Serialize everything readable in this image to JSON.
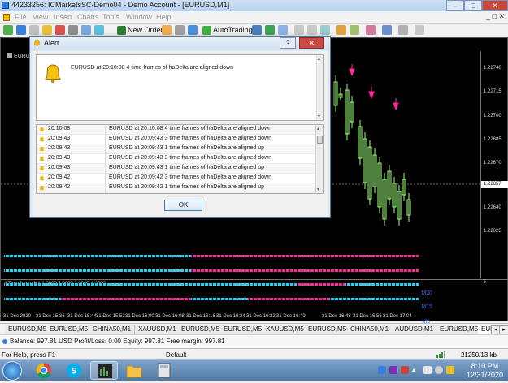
{
  "window": {
    "title": "44233256: ICMarketsSC-Demo04 - Demo Account - [EURUSD,M1]",
    "controls": [
      "–",
      "□",
      "✕"
    ]
  },
  "menu": [
    "File",
    "View",
    "Insert",
    "Charts",
    "Tools",
    "Window",
    "Help"
  ],
  "menu_controls": "_ □ ✕",
  "toolbar": {
    "new_order": "New Order",
    "autotrading": "AutoTrading"
  },
  "chart": {
    "caption": "EURUSD,M1",
    "prices": [
      "1.22740",
      "1.22715",
      "1.22700",
      "1.22685",
      "1.22670",
      "1.22657",
      "1.22640",
      "1.22625"
    ],
    "current_price": "1.22657",
    "indicator_caption": "4 Time frame HA 1.0000 2.0000 3.0000 4.0000",
    "indicator_rows": [
      "M30",
      "M15",
      "M5",
      "M1"
    ],
    "indicator_axis_top": "5",
    "indicator_axis_bottom": "0",
    "time_ticks": [
      "31 Dec 2020",
      "31 Dec 15:36",
      "31 Dec 15:44",
      "31 Dec 15:52",
      "31 Dec 16:00",
      "31 Dec 16:08",
      "31 Dec 16:16",
      "31 Dec 16:24",
      "31 Dec 16:32",
      "31 Dec 16:40",
      "31 Dec 16:48",
      "31 Dec 16:56",
      "31 Dec 17:04"
    ]
  },
  "colors": {
    "bull_candle": "#9eff7a",
    "arrow": "#ff2aa0",
    "indicator_blue": "#21d4f4",
    "indicator_pink": "#ff2a9a"
  },
  "alert": {
    "title": "Alert",
    "help": "?",
    "close": "✕",
    "message": "EURUSD at 20:10:08 4 time frames of haDelta are aligned down",
    "rows": [
      {
        "time": "20:10:08",
        "msg": "EURUSD at 20:10:08 4 time frames of haDelta are aligned down"
      },
      {
        "time": "20:09:43",
        "msg": "EURUSD at 20:09:43 3 time frames of haDelta are aligned down"
      },
      {
        "time": "20:09:43",
        "msg": "EURUSD at 20:09:43 1 time frames of haDelta are aligned up"
      },
      {
        "time": "20:09:43",
        "msg": "EURUSD at 20:09:43 3 time frames of haDelta are aligned down"
      },
      {
        "time": "20:09:43",
        "msg": "EURUSD at 20:09:43 1 time frames of haDelta are aligned up"
      },
      {
        "time": "20:09:42",
        "msg": "EURUSD at 20:09:42 3 time frames of haDelta are aligned down"
      },
      {
        "time": "20:09:42",
        "msg": "EURUSD at 20:09:42 1 time frames of haDelta are aligned up"
      }
    ],
    "ok": "OK"
  },
  "tabs": [
    "EURUSD,M5",
    "EURUSD,M5",
    "CHINA50,M1",
    "XAUUSD,M1",
    "EURUSD,M5",
    "EURUSD,M5",
    "XAUUSD,M5",
    "EURUSD,M5",
    "CHINA50,M1",
    "AUDUSD,M1",
    "EURUSD,M5",
    "EUR"
  ],
  "terminal": {
    "text": "Balance: 997.81 USD  Profit/Loss: 0.00  Equity: 997.81  Free margin: 997.81"
  },
  "status": {
    "help": "For Help, press F1",
    "profile": "Default",
    "connection": "21250/13 kb"
  },
  "clock": {
    "time": "8:10 PM",
    "date": "12/31/2020"
  }
}
